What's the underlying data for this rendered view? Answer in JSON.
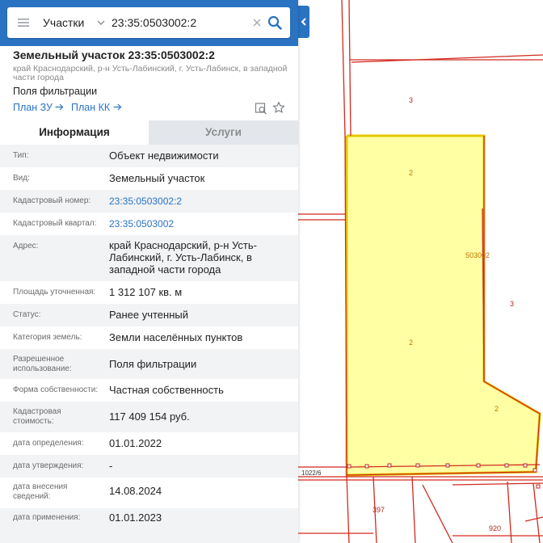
{
  "search": {
    "type_label": "Участки",
    "query": "23:35:0503002:2"
  },
  "parcel": {
    "title": "Земельный участок 23:35:0503002:2",
    "subtitle": "край Краснодарский, р-н Усть-Лабинский, г. Усть-Лабинск, в западной части города",
    "land_use": "Поля фильтрации",
    "plan_zu": "План ЗУ",
    "plan_kk": "План КК"
  },
  "tabs": [
    "Информация",
    "Услуги"
  ],
  "info": [
    {
      "label": "Тип:",
      "value": "Объект недвижимости"
    },
    {
      "label": "Вид:",
      "value": "Земельный участок"
    },
    {
      "label": "Кадастровый номер:",
      "value": "23:35:0503002:2"
    },
    {
      "label": "Кадастровый квартал:",
      "value": "23:35:0503002"
    },
    {
      "label": "Адрес:",
      "value": "край Краснодарский, р-н Усть-Лабинский, г. Усть-Лабинск, в западной части города"
    },
    {
      "label": "Площадь уточненная:",
      "value": "1 312 107 кв. м"
    },
    {
      "label": "Статус:",
      "value": "Ранее учтенный"
    },
    {
      "label": "Категория земель:",
      "value": "Земли населённых пунктов"
    },
    {
      "label": "Разрешенное использование:",
      "value": "Поля фильтрации"
    },
    {
      "label": "Форма собственности:",
      "value": "Частная собственность"
    },
    {
      "label": "Кадастровая стоимость:",
      "value": "117 409 154 руб."
    },
    {
      "label": "дата определения:",
      "value": "01.01.2022"
    },
    {
      "label": "дата утверждения:",
      "value": "-"
    },
    {
      "label": "дата внесения сведений:",
      "value": "14.08.2024"
    },
    {
      "label": "дата применения:",
      "value": "01.01.2023"
    }
  ],
  "map": {
    "labels": [
      "3",
      "2",
      "503002",
      "3",
      "2",
      "2",
      "1022/6",
      "397",
      "920"
    ]
  },
  "colors": {
    "accent": "#2a73c2",
    "parcel_fill": "#ffff99",
    "parcel_border": "#d12a1f"
  },
  "icons": {
    "menu": "hamburger-icon",
    "dropdown": "chevron-down-icon",
    "clear": "close-icon",
    "search": "search-icon",
    "plan_arrow": "arrow-right-icon",
    "find_on_map": "map-search-icon",
    "favorite": "star-icon",
    "collapse": "chevron-left-icon"
  }
}
